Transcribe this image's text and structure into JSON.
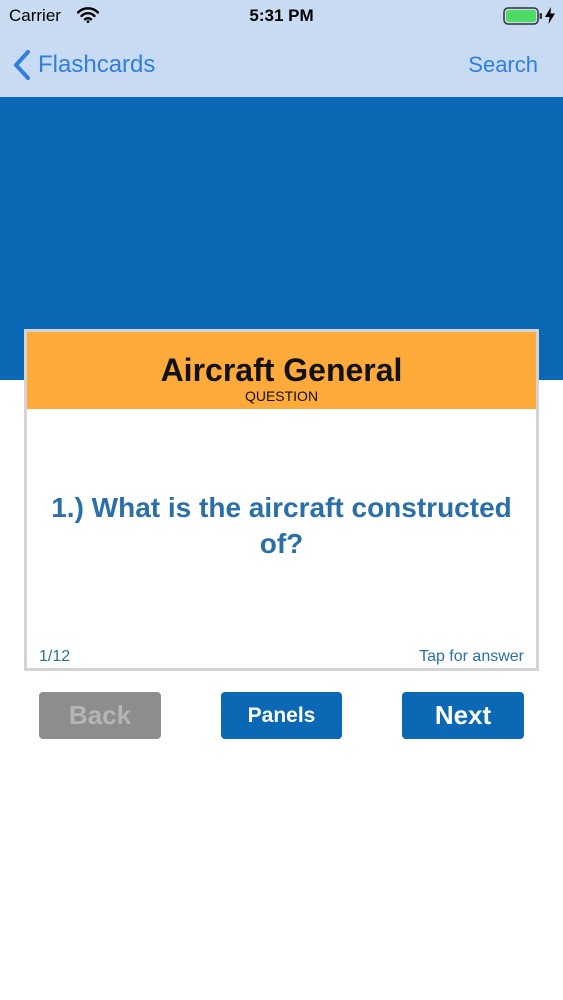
{
  "status_bar": {
    "carrier": "Carrier",
    "time": "5:31 PM"
  },
  "nav": {
    "back_label": "Flashcards",
    "search_label": "Search"
  },
  "card": {
    "title": "Aircraft General",
    "subtitle": "QUESTION",
    "question": "1.) What is the aircraft constructed of?",
    "counter": "1/12",
    "hint": "Tap for answer"
  },
  "buttons": {
    "back_label": "Back",
    "panels_label": "Panels",
    "next_label": "Next"
  },
  "colors": {
    "nav_background": "#c9dbf2",
    "accent_blue": "#0a68b5",
    "link_blue": "#2f7fe0",
    "card_header": "#fdaa3b",
    "question_text": "#2a6fa8",
    "disabled_button": "#8d8d8d",
    "battery_green": "#4cd964"
  },
  "icons": [
    "wifi-icon",
    "battery-icon",
    "charging-icon",
    "chevron-left-icon"
  ]
}
